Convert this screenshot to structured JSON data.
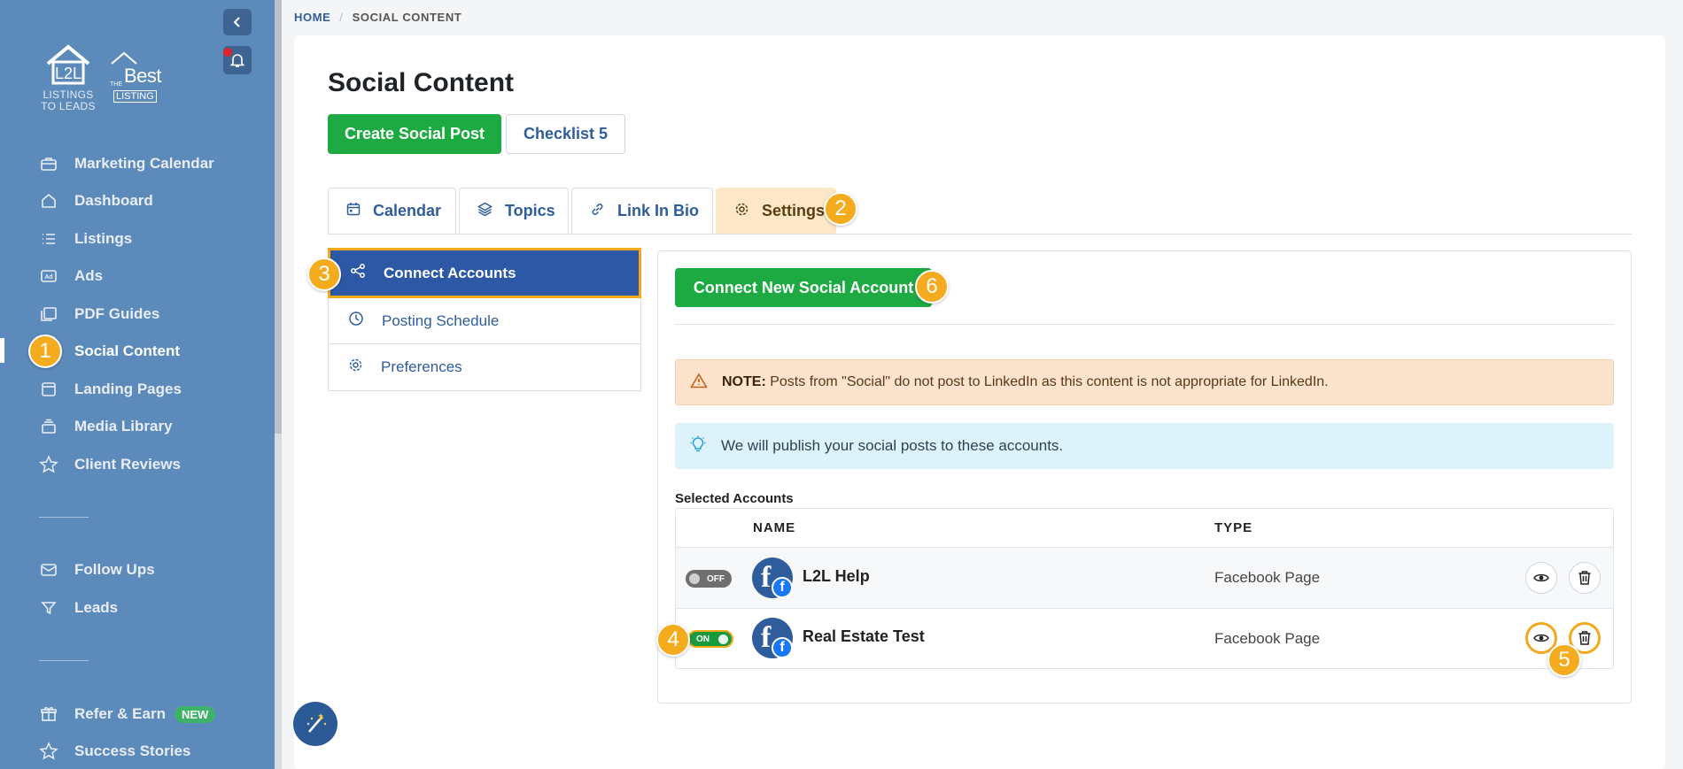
{
  "breadcrumb": {
    "home": "HOME",
    "separator": "/",
    "current": "SOCIAL CONTENT"
  },
  "brand": {
    "logo1_text": "L2L",
    "logo1_sub": "LISTINGS",
    "logo1_sub2": "TO LEADS",
    "logo2_the": "THE",
    "logo2_best": "Best",
    "logo2_listing": "LISTING"
  },
  "sidebar": {
    "items": [
      {
        "label": "Marketing Calendar",
        "icon": "briefcase-icon"
      },
      {
        "label": "Dashboard",
        "icon": "home-icon"
      },
      {
        "label": "Listings",
        "icon": "list-icon"
      },
      {
        "label": "Ads",
        "icon": "ad-icon"
      },
      {
        "label": "PDF Guides",
        "icon": "pdf-icon"
      },
      {
        "label": "Social Content",
        "icon": "none",
        "active": true
      },
      {
        "label": "Landing Pages",
        "icon": "page-icon"
      },
      {
        "label": "Media Library",
        "icon": "stack-icon"
      },
      {
        "label": "Client Reviews",
        "icon": "star-icon"
      },
      {
        "label": "Follow Ups",
        "icon": "mail-icon"
      },
      {
        "label": "Leads",
        "icon": "filter-icon"
      },
      {
        "label": "Refer & Earn",
        "icon": "gift-icon",
        "badge": "NEW"
      },
      {
        "label": "Success Stories",
        "icon": "star-icon"
      }
    ]
  },
  "page": {
    "title": "Social Content",
    "create_button": "Create Social Post",
    "checklist_button": "Checklist 5"
  },
  "tabs": [
    {
      "label": "Calendar",
      "icon": "calendar-icon"
    },
    {
      "label": "Topics",
      "icon": "layers-icon"
    },
    {
      "label": "Link In Bio",
      "icon": "link-icon"
    },
    {
      "label": "Settings",
      "icon": "gear-icon",
      "active": true
    }
  ],
  "settings_nav": [
    {
      "label": "Connect Accounts",
      "icon": "share-icon",
      "active": true
    },
    {
      "label": "Posting Schedule",
      "icon": "clock-icon"
    },
    {
      "label": "Preferences",
      "icon": "gear-icon"
    }
  ],
  "panel": {
    "connect_button": "Connect New Social Account",
    "note_label": "NOTE:",
    "note_text": "Posts from \"Social\" do not post to LinkedIn as this content is not appropriate for LinkedIn.",
    "info_text": "We will publish your social posts to these accounts.",
    "selected_label": "Selected Accounts"
  },
  "table": {
    "headers": {
      "name": "NAME",
      "type": "TYPE"
    },
    "rows": [
      {
        "toggle": "OFF",
        "name": "L2L Help",
        "type": "Facebook Page"
      },
      {
        "toggle": "ON",
        "name": "Real Estate Test",
        "type": "Facebook Page"
      }
    ]
  },
  "steps": [
    "1",
    "2",
    "3",
    "4",
    "5",
    "6"
  ],
  "colors": {
    "sidebar": "#5b8abb",
    "primary": "#2c58a6",
    "green": "#1eaa43",
    "highlight": "#f5ab1e",
    "warning_bg": "#fbe3cd",
    "info_bg": "#def2fb"
  }
}
